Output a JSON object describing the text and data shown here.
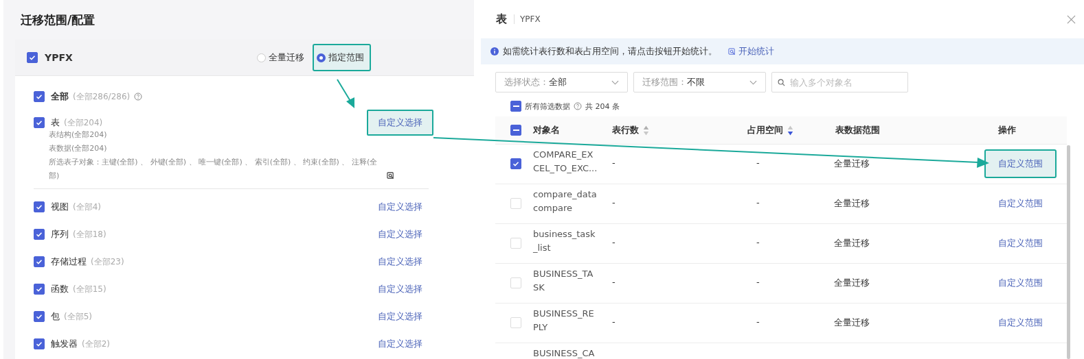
{
  "left": {
    "title": "迁移范围/配置",
    "schema": {
      "name": "YPFX",
      "checked": true
    },
    "modes": [
      {
        "label": "全量迁移",
        "selected": false,
        "highlighted": false
      },
      {
        "label": "指定范围",
        "selected": true,
        "highlighted": true
      }
    ],
    "all": {
      "label": "全部",
      "count": "(全部286/286)",
      "checked": true
    },
    "items": [
      {
        "label": "表",
        "count": "(全部204)",
        "checked": true,
        "action": "自定义选择",
        "highlighted": true,
        "details": [
          "表结构(全部204)",
          "表数据(全部204)",
          "所选表子对象：主键(全部) 、 外键(全部) 、 唯一键(全部) 、 索引(全部) 、 约束(全部) 、 注释(全部)"
        ]
      },
      {
        "label": "视图",
        "count": "(全部4)",
        "checked": true,
        "action": "自定义选择",
        "highlighted": false
      },
      {
        "label": "序列",
        "count": "(全部18)",
        "checked": true,
        "action": "自定义选择",
        "highlighted": false
      },
      {
        "label": "存储过程",
        "count": "(全部23)",
        "checked": true,
        "action": "自定义选择",
        "highlighted": false
      },
      {
        "label": "函数",
        "count": "(全部15)",
        "checked": true,
        "action": "自定义选择",
        "highlighted": false
      },
      {
        "label": "包",
        "count": "(全部5)",
        "checked": true,
        "action": "自定义选择",
        "highlighted": false
      },
      {
        "label": "触发器",
        "count": "(全部2)",
        "checked": true,
        "action": "自定义选择",
        "highlighted": false
      }
    ]
  },
  "dialog": {
    "title": "表",
    "subtitle": "YPFX",
    "notice": "如需统计表行数和表占用空间，请点击按钮开始统计。",
    "notice_link": "开始统计",
    "filters": [
      {
        "kind": "select",
        "label": "选择状态：",
        "value": "全部"
      },
      {
        "kind": "select",
        "label": "迁移范围：",
        "value": "不限"
      },
      {
        "kind": "search",
        "placeholder": "输入多个对象名"
      }
    ],
    "select_all": {
      "label": "所有筛选数据",
      "total": "共 204 条",
      "indeterminate": true
    },
    "table": {
      "header_indeterminate": true,
      "columns": [
        {
          "label": "对象名"
        },
        {
          "label": "表行数",
          "sortable": true,
          "sort_desc": false
        },
        {
          "label": "占用空间",
          "sortable": true,
          "sort_desc": true
        },
        {
          "label": "表数据范围"
        },
        {
          "label": "操作"
        }
      ],
      "rows": [
        {
          "name": "COMPARE_EXCEL_TO_EXC...",
          "row_count": "-",
          "size": "-",
          "range": "全量迁移",
          "action": "自定义范围",
          "checked": true,
          "highlighted": true
        },
        {
          "name": "compare_datacompare",
          "row_count": "-",
          "size": "-",
          "range": "全量迁移",
          "action": "自定义范围",
          "checked": false,
          "highlighted": false
        },
        {
          "name": "business_task_list",
          "row_count": "-",
          "size": "-",
          "range": "全量迁移",
          "action": "自定义范围",
          "checked": false,
          "highlighted": false
        },
        {
          "name": "BUSINESS_TASK",
          "row_count": "-",
          "size": "-",
          "range": "全量迁移",
          "action": "自定义范围",
          "checked": false,
          "highlighted": false
        },
        {
          "name": "BUSINESS_REPLY",
          "row_count": "-",
          "size": "-",
          "range": "全量迁移",
          "action": "自定义范围",
          "checked": false,
          "highlighted": false
        },
        {
          "name": "BUSINESS_CA"
        }
      ]
    }
  }
}
